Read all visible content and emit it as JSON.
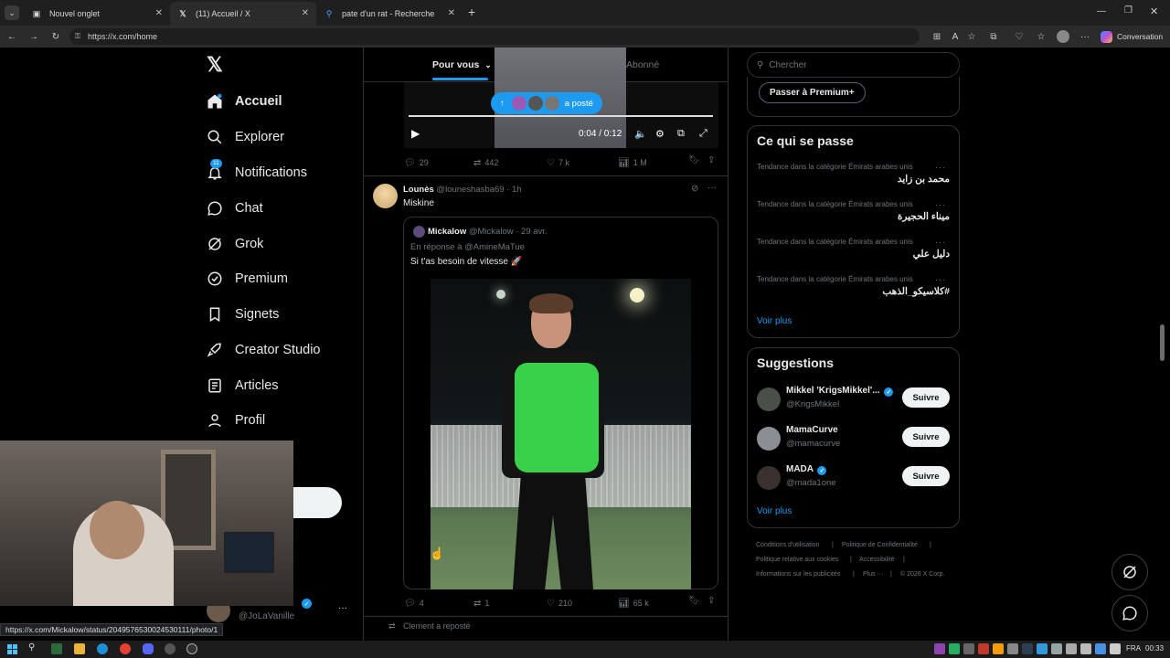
{
  "browser": {
    "tabs": [
      {
        "label": "Nouvel onglet"
      },
      {
        "label": "(11) Accueil / X"
      },
      {
        "label": "pate d'un rat - Recherche"
      }
    ],
    "url": "https://x.com/home",
    "copilot_label": "Conversation",
    "status_url": "https://x.com/Mickalow/status/2049576530024530111/photo/1"
  },
  "nav": {
    "items": [
      {
        "label": "Accueil",
        "icon": "home-icon"
      },
      {
        "label": "Explorer",
        "icon": "search-icon"
      },
      {
        "label": "Notifications",
        "icon": "bell-icon",
        "badge": "11"
      },
      {
        "label": "Chat",
        "icon": "chat-icon"
      },
      {
        "label": "Grok",
        "icon": "grok-icon"
      },
      {
        "label": "Premium",
        "icon": "premium-icon"
      },
      {
        "label": "Signets",
        "icon": "bookmark-icon"
      },
      {
        "label": "Creator Studio",
        "icon": "rocket-icon"
      },
      {
        "label": "Articles",
        "icon": "articles-icon"
      },
      {
        "label": "Profil",
        "icon": "profile-icon"
      }
    ],
    "account": {
      "name": "JoLaVanille",
      "handle": "@JoLaVanille"
    }
  },
  "feed": {
    "tabs": {
      "for_you": "Pour vous",
      "following": "Abonné"
    },
    "posted_pill": "a posté",
    "video": {
      "time": "0:04 / 0:12"
    },
    "prev_stats": {
      "replies": "29",
      "reposts": "442",
      "likes": "7 k",
      "views": "1 M"
    },
    "post": {
      "author": "Lounès",
      "handle": "@louneshasba69",
      "time": "· 1h",
      "text": "Miskine",
      "quote": {
        "author": "Mickalow",
        "handle": "@Mickalow",
        "time": "· 29 avr.",
        "reply_to": "En réponse à @AmineMaTue",
        "text": "Si t'as besoin de vitesse 🚀"
      },
      "stats": {
        "replies": "4",
        "reposts": "1",
        "likes": "210",
        "views": "65 k"
      }
    },
    "next_repost": "Clement a reposté"
  },
  "sidebar": {
    "search_placeholder": "Chercher",
    "premium_button": "Passer à Premium+",
    "trends_title": "Ce qui se passe",
    "trends": [
      {
        "category": "Tendance dans la catégorie Émirats arabes unis",
        "name": "محمد بن زايد"
      },
      {
        "category": "Tendance dans la catégorie Émirats arabes unis",
        "name": "ميناء الحجيرة"
      },
      {
        "category": "Tendance dans la catégorie Émirats arabes unis",
        "name": "دليل علي"
      },
      {
        "category": "Tendance dans la catégorie Émirats arabes unis",
        "name": "#كلاسيكو_الذهب"
      }
    ],
    "see_more": "Voir plus",
    "suggestions_title": "Suggestions",
    "suggestions": [
      {
        "name": "Mikkel 'KrigsMikkel'...",
        "handle": "@KrigsMikkel",
        "verified": true
      },
      {
        "name": "MamaCurve",
        "handle": "@mamacurve",
        "verified": false
      },
      {
        "name": "MADA",
        "handle": "@mada1one",
        "verified": true
      }
    ],
    "follow_label": "Suivre",
    "footer": {
      "terms": "Conditions d'utilisation",
      "privacy": "Politique de Confidentialité",
      "cookies": "Politique relative aux cookies",
      "accessibility": "Accessibilité",
      "ads": "Informations sur les publicités",
      "more": "Plus ···",
      "copyright": "© 2026 X Corp."
    }
  },
  "taskbar": {
    "lang": "FRA",
    "time": "00:33"
  },
  "colors": {
    "accent": "#1d9bf0",
    "border": "#2f3336",
    "muted": "#71767b",
    "bg": "#000000"
  }
}
